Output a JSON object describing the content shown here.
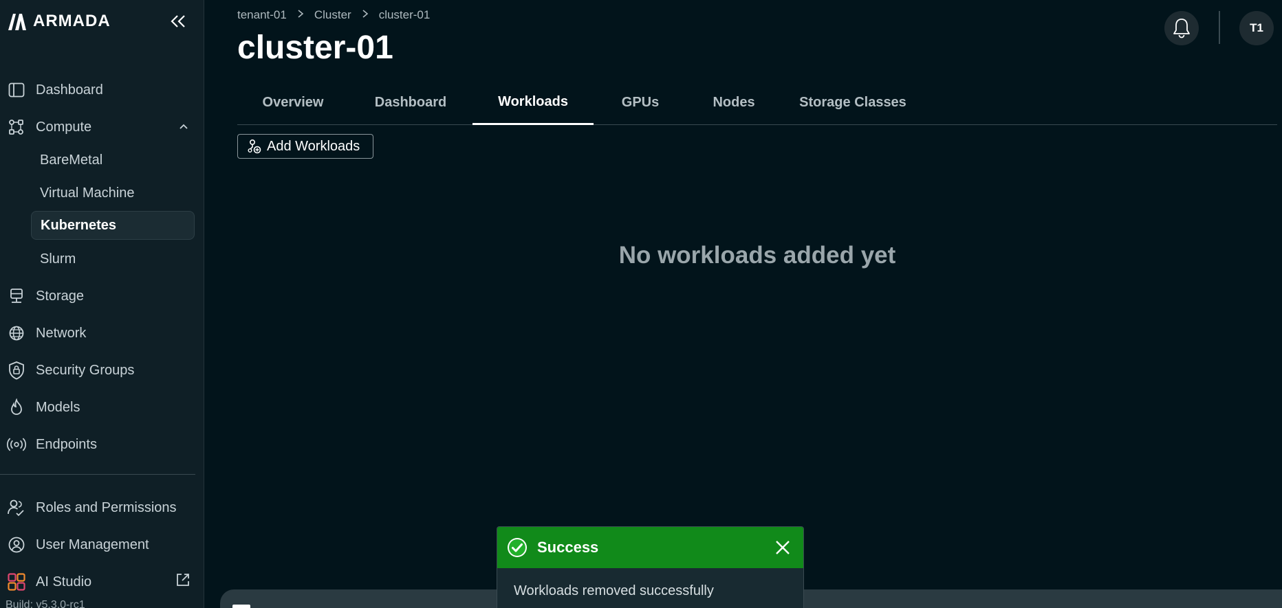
{
  "brand": {
    "name": "ARMADA"
  },
  "sidebar": {
    "items": [
      {
        "label": "Dashboard"
      },
      {
        "label": "Compute"
      },
      {
        "label": "Storage"
      },
      {
        "label": "Network"
      },
      {
        "label": "Security Groups"
      },
      {
        "label": "Models"
      },
      {
        "label": "Endpoints"
      },
      {
        "label": "Roles and Permissions"
      },
      {
        "label": "User Management"
      },
      {
        "label": "AI Studio"
      }
    ],
    "compute_sub": [
      {
        "label": "BareMetal"
      },
      {
        "label": "Virtual Machine"
      },
      {
        "label": "Kubernetes"
      },
      {
        "label": "Slurm"
      }
    ],
    "active_sub": "Kubernetes",
    "build": "Build: v5.3.0-rc1"
  },
  "header": {
    "breadcrumb": [
      "tenant-01",
      "Cluster",
      "cluster-01"
    ],
    "title": "cluster-01",
    "avatar_initials": "T1"
  },
  "tabs": [
    {
      "label": "Overview"
    },
    {
      "label": "Dashboard"
    },
    {
      "label": "Workloads"
    },
    {
      "label": "GPUs"
    },
    {
      "label": "Nodes"
    },
    {
      "label": "Storage Classes"
    }
  ],
  "active_tab": "Workloads",
  "main": {
    "add_button": "Add Workloads",
    "empty_message": "No workloads added yet"
  },
  "toast": {
    "title": "Success",
    "message": "Workloads removed successfully",
    "color": "#118a1a"
  },
  "icons": {
    "collapse": "double-chevron-left-icon",
    "bell": "bell-icon",
    "check": "check-circle-icon",
    "close": "close-icon",
    "external": "external-link-icon"
  }
}
